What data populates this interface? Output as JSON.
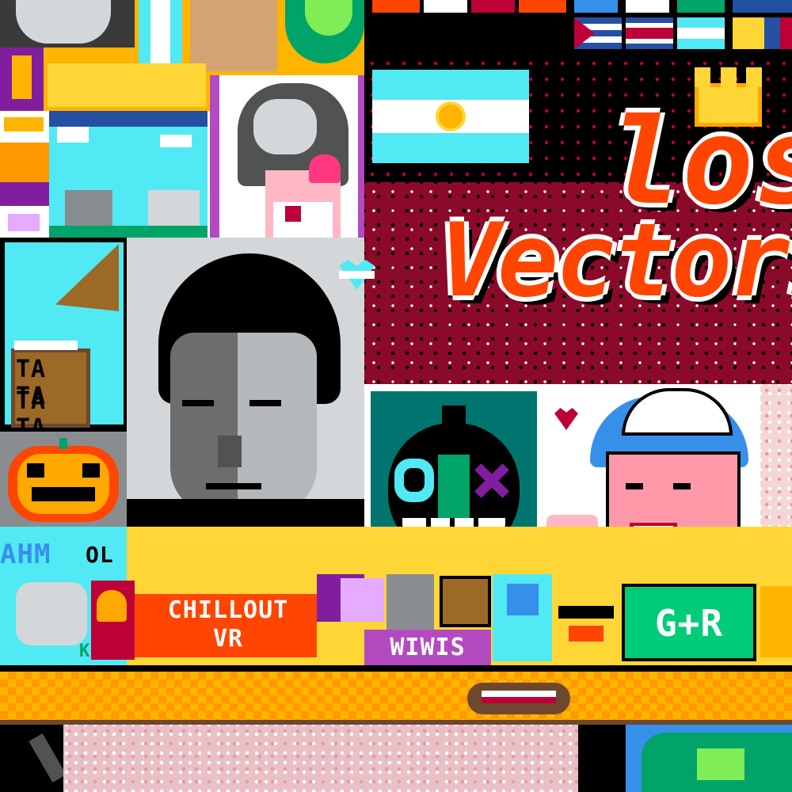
{
  "artwork": {
    "kind": "pixel-art collage",
    "palette": {
      "black": "#000000",
      "white": "#ffffff",
      "orange": "#ff4500",
      "amber": "#ffa800",
      "sky": "#51e9f4",
      "teal": "#00756f",
      "crimson": "#be0039",
      "purple": "#811e9f",
      "gray": "#898d90",
      "light_gray": "#d4d7d9",
      "pink": "#ff99aa",
      "green": "#00cc78",
      "blue": "#3690ea",
      "brown": "#9c6926",
      "yellow": "#ffd635"
    }
  },
  "texts": {
    "los": "los",
    "vectors": "Vectors",
    "tata_1": "TA TA",
    "tata_2": "TA TA",
    "chillout_1": "CHILLOUT",
    "chillout_2": "VR",
    "wiwis": "WIWIS",
    "gr": "G+R",
    "ahm": "AHM",
    "ol": "OL",
    "kiru": "KIRU"
  },
  "flags": [
    {
      "name": "netherlands",
      "colors": [
        "#be0039",
        "#ffffff",
        "#3690ea"
      ]
    },
    {
      "name": "cuba",
      "colors": [
        "#2450a4",
        "#ffffff",
        "#2450a4"
      ]
    },
    {
      "name": "costa-rica",
      "colors": [
        "#2450a4",
        "#ffffff",
        "#be0039",
        "#ffffff",
        "#2450a4"
      ]
    },
    {
      "name": "argentina-small",
      "colors": [
        "#51e9f4",
        "#ffffff",
        "#51e9f4"
      ]
    },
    {
      "name": "colombia",
      "colors": [
        "#ffd635",
        "#2450a4",
        "#be0039"
      ]
    }
  ]
}
